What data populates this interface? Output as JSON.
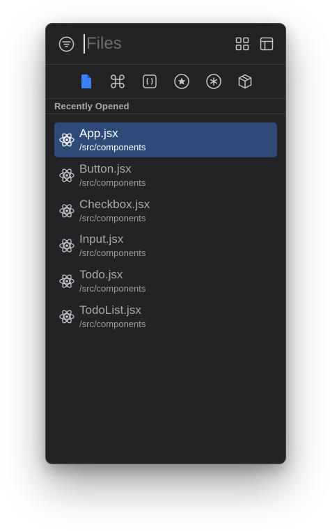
{
  "search": {
    "placeholder": "Files",
    "value": ""
  },
  "icons": {
    "filter": "filter-icon",
    "grid": "grid-icon",
    "layout": "sidebar-layout-icon"
  },
  "tabs": [
    {
      "icon": "file-icon",
      "active": true
    },
    {
      "icon": "command-icon",
      "active": false
    },
    {
      "icon": "braces-icon",
      "active": false
    },
    {
      "icon": "star-icon",
      "active": false
    },
    {
      "icon": "asterisk-icon",
      "active": false
    },
    {
      "icon": "package-icon",
      "active": false
    }
  ],
  "section": {
    "title": "Recently Opened"
  },
  "items": [
    {
      "name": "App.jsx",
      "path": "/src/components",
      "icon": "react-icon",
      "selected": true
    },
    {
      "name": "Button.jsx",
      "path": "/src/components",
      "icon": "react-icon",
      "selected": false
    },
    {
      "name": "Checkbox.jsx",
      "path": "/src/components",
      "icon": "react-icon",
      "selected": false
    },
    {
      "name": "Input.jsx",
      "path": "/src/components",
      "icon": "react-icon",
      "selected": false
    },
    {
      "name": "Todo.jsx",
      "path": "/src/components",
      "icon": "react-icon",
      "selected": false
    },
    {
      "name": "TodoList.jsx",
      "path": "/src/components",
      "icon": "react-icon",
      "selected": false
    }
  ],
  "colors": {
    "panel_bg": "#232326",
    "selected_bg": "#2f4a78",
    "accent": "#3b82f6",
    "icon": "#c7c7cc"
  }
}
